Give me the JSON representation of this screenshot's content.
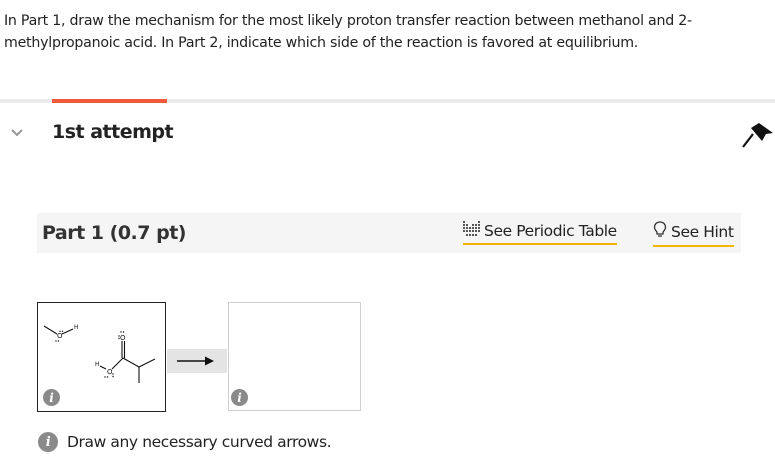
{
  "question": {
    "prompt": "In Part 1, draw the mechanism for the most likely proton transfer reaction between methanol and 2-methylpropanoic acid. In Part 2, indicate which side of the reaction is favored at equilibrium."
  },
  "attempt": {
    "title": "1st attempt"
  },
  "part": {
    "title": "Part 1 (0.7 pt)",
    "periodic_table_label": "See Periodic Table",
    "hint_label": "See Hint"
  },
  "drawing": {
    "methanol_labels": {
      "oxygen": "O",
      "hydrogen": "H"
    },
    "acid_labels": {
      "carbonyl_oxygen": "O",
      "hydroxyl_oxygen": "O",
      "hydrogen": "H"
    },
    "info_glyph": "i"
  },
  "footer": {
    "note": "Draw any necessary curved arrows."
  },
  "colors": {
    "accent": "#f05a3a",
    "link_underline": "#f2b600",
    "info_gray": "#8a8a8a"
  },
  "icons": [
    "chevron-down-icon",
    "bookmark-icon",
    "periodic-table-icon",
    "lightbulb-icon",
    "info-icon",
    "arrow-right-icon"
  ]
}
